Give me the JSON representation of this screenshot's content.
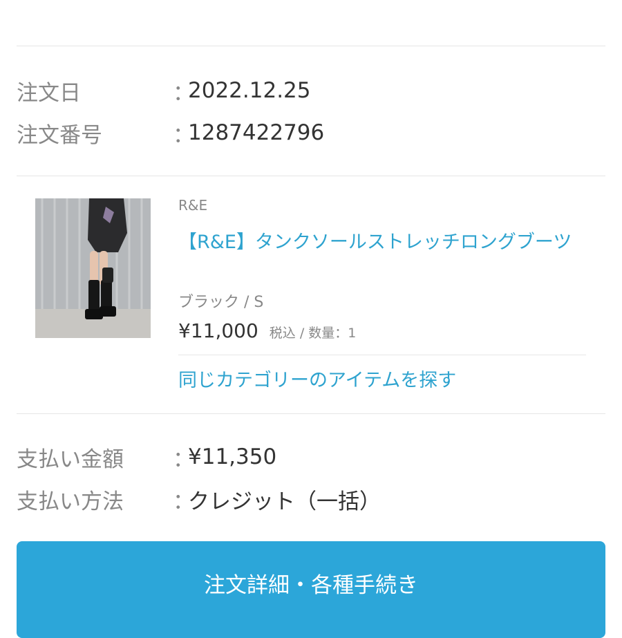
{
  "order": {
    "date_label": "注文日",
    "date_value": "2022.12.25",
    "number_label": "注文番号",
    "number_value": "1287422796",
    "separator": "："
  },
  "item": {
    "brand": "R&E",
    "name": "【R&E】タンクソールストレッチロングブーツ",
    "variant": "ブラック / S",
    "price": "¥11,000",
    "price_meta": "税込 / 数量：1",
    "category_link": "同じカテゴリーのアイテムを探す",
    "image_icon": "product-photo-boots"
  },
  "payment": {
    "amount_label": "支払い金額",
    "amount_value": "¥11,350",
    "method_label": "支払い方法",
    "method_value": "クレジット（一括）",
    "separator": "："
  },
  "actions": {
    "details_button": "注文詳細・各種手続き"
  },
  "colors": {
    "link": "#2ea3cf",
    "button": "#2ca6d9",
    "label": "#888888",
    "text": "#333333"
  }
}
